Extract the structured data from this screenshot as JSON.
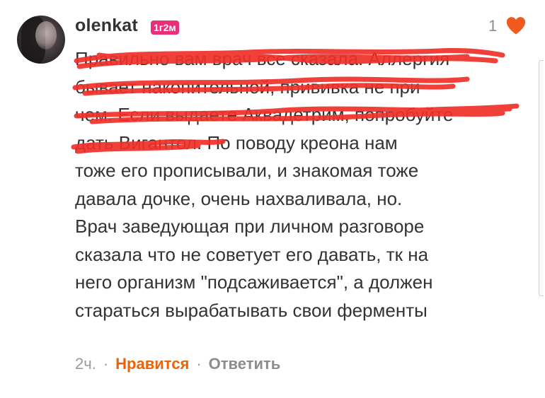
{
  "comment": {
    "username": "olenkat",
    "badge": "1г2м",
    "likes": "1",
    "text_lines": [
      "Правильно вам врач все сказала. Аллергия",
      "бывает накопительной, прививка не при",
      "чем. Если выдаете Аквадетрим, попробуйте",
      "дать Вигантол. По поводу креона нам",
      "тоже его прописывали, и знакомая тоже",
      "давала дочке, очень нахваливала, но.",
      "Врач заведующая при личном разговоре",
      "сказала что не советует его давать, тк на",
      "него организм \"подсаживается\", а должен",
      "стараться вырабатывать свои ферменты"
    ],
    "time": "2ч.",
    "like_action": "Нравится",
    "reply_action": "Ответить"
  },
  "colors": {
    "badge": "#ea2f7a",
    "heart": "#f05a1e",
    "like_action": "#e8630a",
    "redaction": "#f0302a"
  },
  "icons": {
    "heart": "heart-icon"
  }
}
